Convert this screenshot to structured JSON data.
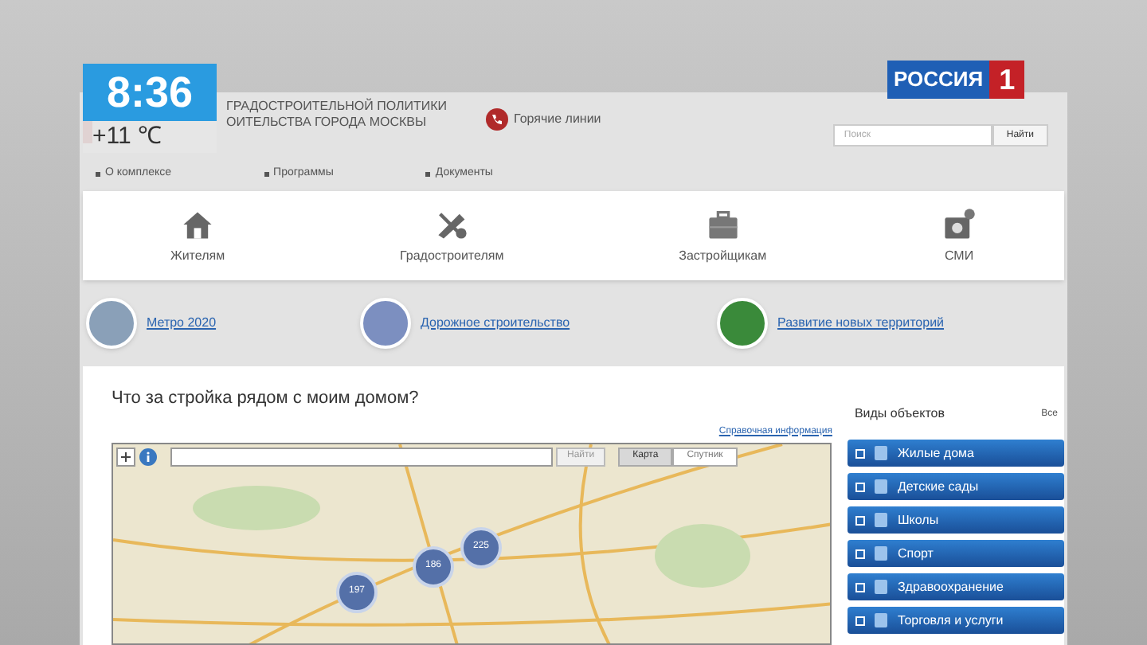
{
  "tv_overlay": {
    "clock": "8:36",
    "temperature": "+11 ℃",
    "channel_logo": {
      "name": "РОССИЯ",
      "number": "1"
    }
  },
  "header": {
    "title_lines": [
      "ГРАДОСТРОИТЕЛЬНОЙ ПОЛИТИКИ",
      "ОИТЕЛЬСТВА ГОРОДА МОСКВЫ"
    ],
    "hotline": "Горячие линии",
    "search": {
      "placeholder": "Поиск",
      "button": "Найти"
    }
  },
  "nav": [
    "О комплексе",
    "Программы",
    "Документы"
  ],
  "audiences": [
    {
      "label": "Жителям",
      "kind": "house"
    },
    {
      "label": "Градостроителям",
      "kind": "tools"
    },
    {
      "label": "Застройщикам",
      "kind": "briefcase"
    },
    {
      "label": "СМИ",
      "kind": "camera"
    }
  ],
  "programs": [
    "Метро 2020",
    "Дорожное строительство",
    "Развитие новых территорий"
  ],
  "main": {
    "title": "Что за стройка рядом с моим домом?",
    "help_link": "Справочная информация",
    "map": {
      "search_button": "Найти",
      "view_toggle": [
        {
          "label": "Карта",
          "selected": true
        },
        {
          "label": "Спутник",
          "selected": false
        }
      ],
      "clusters": [
        "197",
        "186",
        "225"
      ]
    }
  },
  "sidebar": {
    "title": "Виды объектов",
    "all_link": "Все",
    "items": [
      {
        "label": "Жилые дома",
        "checked": false
      },
      {
        "label": "Детские сады",
        "checked": false
      },
      {
        "label": "Школы",
        "checked": false
      },
      {
        "label": "Спорт",
        "checked": false
      },
      {
        "label": "Здравоохранение",
        "checked": false
      },
      {
        "label": "Торговля и услуги",
        "checked": false
      }
    ]
  }
}
